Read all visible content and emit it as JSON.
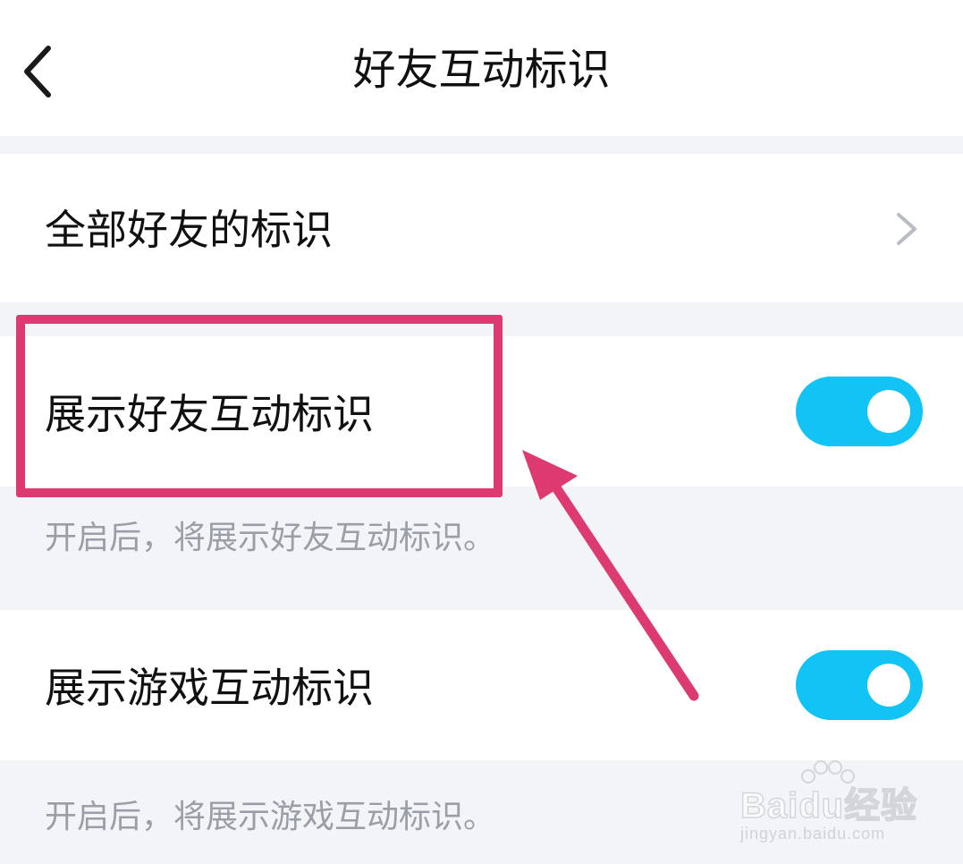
{
  "header": {
    "title": "好友互动标识",
    "back_icon": "chevron-left-icon"
  },
  "settings": {
    "all_friends": {
      "label": "全部好友的标识",
      "icon": "chevron-right-icon"
    },
    "show_friend_marks": {
      "label": "展示好友互动标识",
      "enabled": true,
      "description": "开启后，将展示好友互动标识。"
    },
    "show_game_marks": {
      "label": "展示游戏互动标识",
      "enabled": true,
      "description": "开启后，将展示游戏互动标识。"
    }
  },
  "colors": {
    "toggle_on": "#12c3f5",
    "annotation": "#dd3a72",
    "background": "#f3f4f8",
    "description_text": "#9a9ea6"
  },
  "watermark": {
    "brand": "Baidu经验",
    "url": "jingyan.baidu.com"
  }
}
